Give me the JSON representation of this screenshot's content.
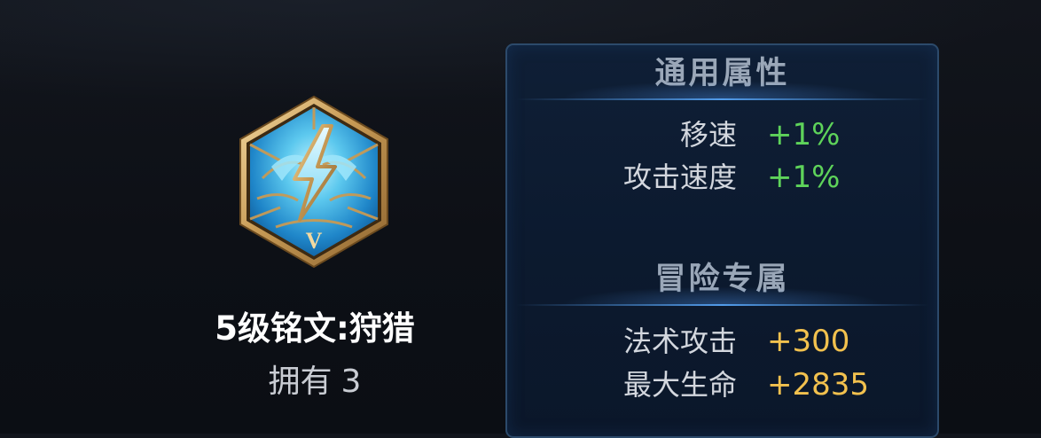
{
  "rune": {
    "title": "5级铭文:狩猎",
    "owned_label": "拥有",
    "owned_count": "3",
    "tier_mark": "V",
    "icon": "lightning-rune-icon"
  },
  "stats": {
    "general": {
      "header": "通用属性",
      "items": [
        {
          "label": "移速",
          "value": "+1%"
        },
        {
          "label": "攻击速度",
          "value": "+1%"
        }
      ]
    },
    "adventure": {
      "header": "冒险专属",
      "items": [
        {
          "label": "法术攻击",
          "value": "+300"
        },
        {
          "label": "最大生命",
          "value": "+2835"
        }
      ]
    }
  },
  "colors": {
    "general_value": "#5ed35a",
    "adventure_value": "#f2c14e",
    "panel_border": "#2c4a6b",
    "header_text": "#9aa7b8"
  }
}
